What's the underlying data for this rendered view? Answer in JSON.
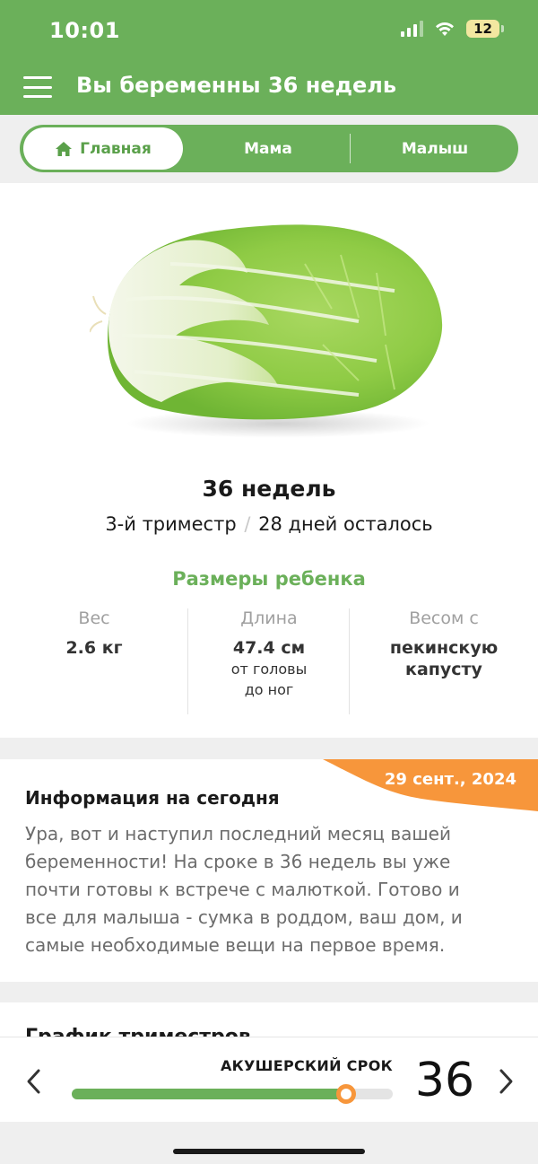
{
  "status_bar": {
    "time": "10:01",
    "battery": "12"
  },
  "header": {
    "title": "Вы беременны 36 недель"
  },
  "tabs": [
    {
      "label": "Главная",
      "active": true
    },
    {
      "label": "Мама",
      "active": false
    },
    {
      "label": "Малыш",
      "active": false
    }
  ],
  "week": {
    "title": "36 недель",
    "trimester": "3-й триместр",
    "separator": "/",
    "days_left": "28 дней осталось"
  },
  "sizes": {
    "title": "Размеры ребенка",
    "weight": {
      "label": "Вес",
      "value": "2.6 кг"
    },
    "length": {
      "label": "Длина",
      "value": "47.4 см",
      "extra_1": "от головы",
      "extra_2": "до ног"
    },
    "compare": {
      "label": "Весом с",
      "value_1": "пекинскую",
      "value_2": "капусту"
    }
  },
  "info": {
    "date": "29 сент., 2024",
    "title": "Информация на сегодня",
    "lines": [
      "Ура, вот и наступил последний месяц вашей",
      "беременности! На сроке в 36 недель вы уже",
      "почти готовы к встрече с малюткой. Готово и",
      "все для малыша - сумка в роддом, ваш дом, и",
      "самые необходимые вещи на первое время."
    ]
  },
  "trimester_card": {
    "title": "График триместров"
  },
  "bottom_bar": {
    "label": "АКУШЕРСКИЙ СРОК",
    "week_number": "36",
    "progress": 0.855
  },
  "colors": {
    "brand_green": "#6bb05a",
    "accent_orange": "#f7963b",
    "text_gray": "#6c6c6c"
  },
  "icons": [
    "menu-icon",
    "home-icon",
    "chevron-left-icon",
    "chevron-right-icon",
    "signal-icon",
    "wifi-icon",
    "battery-icon"
  ]
}
